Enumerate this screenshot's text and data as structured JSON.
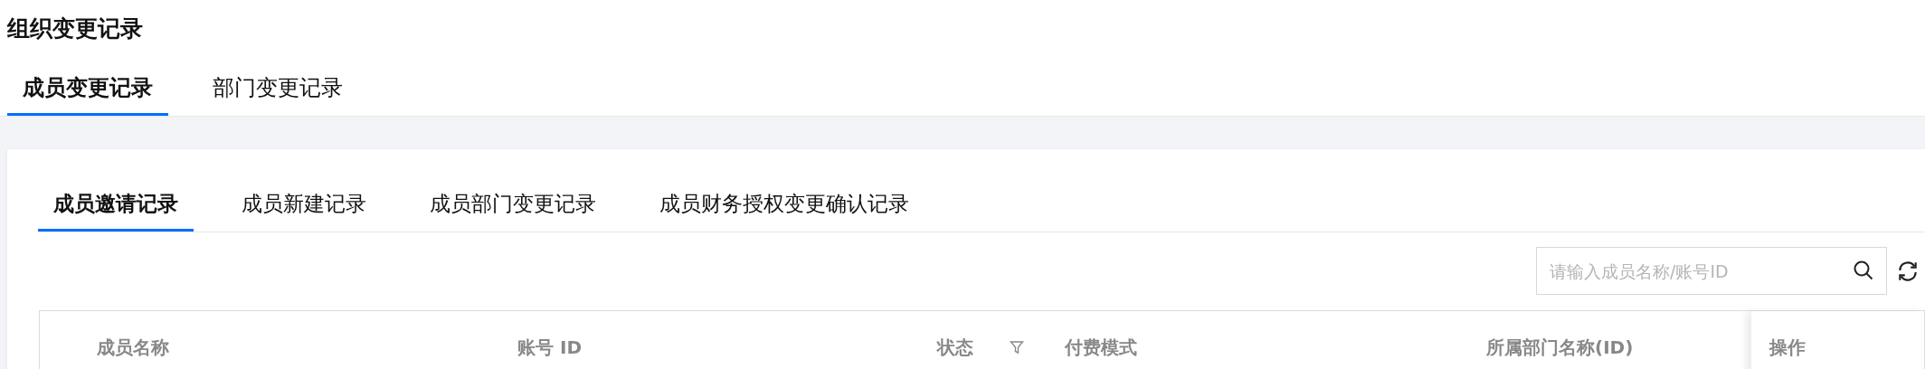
{
  "page_title": "组织变更记录",
  "tabs": [
    {
      "label": "成员变更记录",
      "selected": true
    },
    {
      "label": "部门变更记录",
      "selected": false
    }
  ],
  "sub_tabs": [
    {
      "label": "成员邀请记录",
      "selected": true
    },
    {
      "label": "成员新建记录",
      "selected": false
    },
    {
      "label": "成员部门变更记录",
      "selected": false
    },
    {
      "label": "成员财务授权变更确认记录",
      "selected": false
    }
  ],
  "search": {
    "placeholder": "请输入成员名称/账号ID"
  },
  "table": {
    "columns": [
      {
        "label": "成员名称",
        "kind": "plain"
      },
      {
        "label": "账号 ID",
        "kind": "plain"
      },
      {
        "label": "状态",
        "kind": "filter"
      },
      {
        "label": "付费模式",
        "kind": "plain"
      },
      {
        "label": "所属部门名称(ID)",
        "kind": "plain"
      },
      {
        "label": "操作",
        "kind": "fixed"
      }
    ]
  }
}
